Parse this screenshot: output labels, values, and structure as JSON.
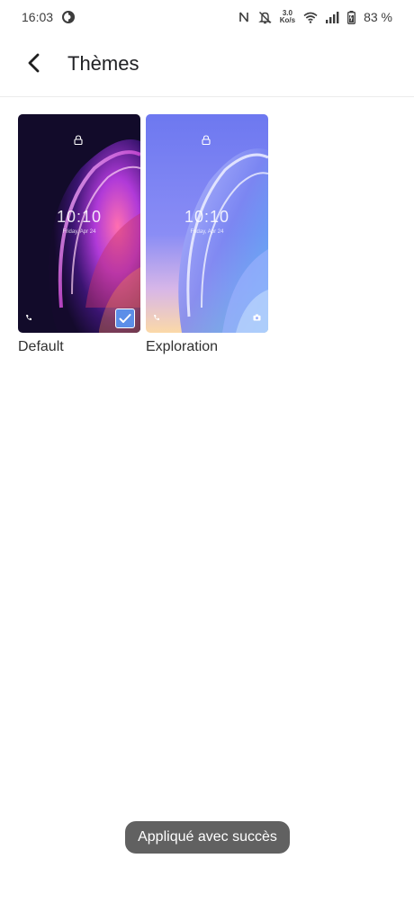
{
  "status_bar": {
    "time": "16:03",
    "net_speed_value": "3.0",
    "net_speed_unit": "Ko/s",
    "battery": "83 %",
    "icons": [
      "data-saver-icon",
      "nfc-icon",
      "mute-icon",
      "wifi-icon",
      "signal-icon",
      "battery-icon"
    ]
  },
  "header": {
    "title": "Thèmes",
    "back_icon": "back-arrow-icon"
  },
  "themes": [
    {
      "name": "Default",
      "clock": "10:10",
      "date": "Friday, Apr 24",
      "selected": true
    },
    {
      "name": "Exploration",
      "clock": "10:10",
      "date": "Friday, Apr 24",
      "selected": false
    }
  ],
  "toast": {
    "message": "Appliqué avec succès"
  },
  "colors": {
    "accent_check": "#5b8ee8",
    "toast_bg": "#616161"
  }
}
